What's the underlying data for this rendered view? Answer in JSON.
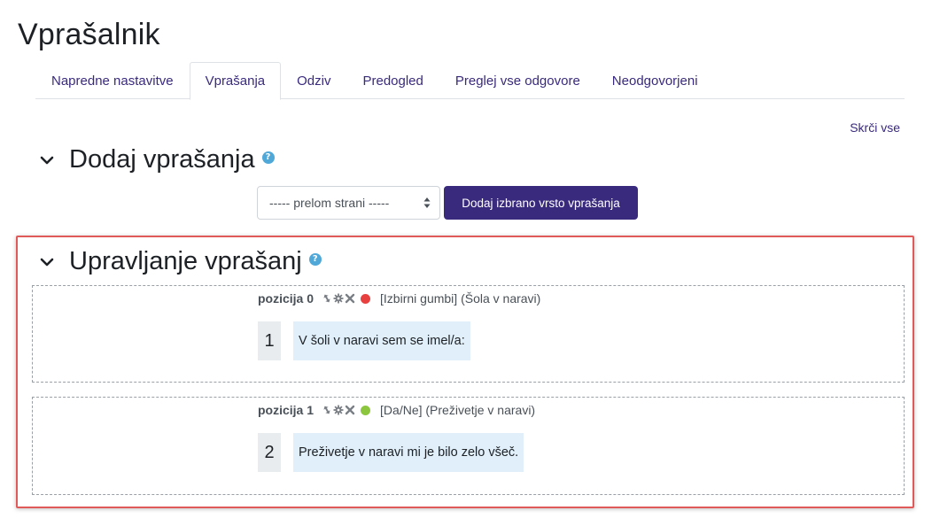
{
  "page": {
    "title": "Vprašalnik"
  },
  "tabs": [
    {
      "label": "Napredne nastavitve",
      "active": false
    },
    {
      "label": "Vprašanja",
      "active": true
    },
    {
      "label": "Odziv",
      "active": false
    },
    {
      "label": "Predogled",
      "active": false
    },
    {
      "label": "Preglej vse odgovore",
      "active": false
    },
    {
      "label": "Neodgovorjeni",
      "active": false
    }
  ],
  "collapse_all": "Skrči vse",
  "add_section": {
    "title": "Dodaj vprašanja",
    "select_value": "----- prelom strani -----",
    "button_label": "Dodaj izbrano vrsto vprašanja"
  },
  "manage_section": {
    "title": "Upravljanje vprašanj",
    "questions": [
      {
        "position": "pozicija 0",
        "status_color": "#e8403f",
        "type": "[Izbirni gumbi] (Šola v naravi)",
        "number": "1",
        "text": "V šoli v naravi sem se imel/a:"
      },
      {
        "position": "pozicija 1",
        "status_color": "#8cc63f",
        "type": "[Da/Ne] (Preživetje v naravi)",
        "number": "2",
        "text": "Preživetje v naravi mi je bilo zelo všeč."
      }
    ]
  },
  "colors": {
    "brand": "#3a2a7d",
    "highlight": "#e05a5a",
    "help": "#4fa8d8"
  }
}
